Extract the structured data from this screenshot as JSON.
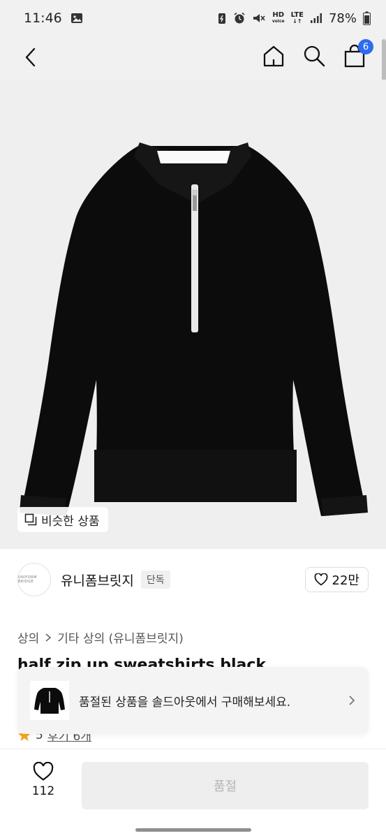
{
  "status_bar": {
    "time": "11:46",
    "hd_top": "HD",
    "hd_bottom": "voice",
    "lte": "LTE",
    "battery": "78%"
  },
  "nav": {
    "cart_count": "6"
  },
  "image": {
    "similar_label": "비슷한 상품"
  },
  "brand": {
    "logo_text": "UNIFORM BRIDGE",
    "name": "유니폼브릿지",
    "badge": "단독",
    "likes": "22만"
  },
  "breadcrumb": {
    "level1": "상의",
    "level2": "기타 상의 (유니폼브릿지)"
  },
  "product": {
    "title": "half zip up sweatshirts black",
    "rating": "5",
    "reviews": "후기 6개"
  },
  "toast": {
    "message": "품절된 상품을 솔드아웃에서 구매해보세요."
  },
  "bottom": {
    "like_count": "112",
    "soldout_label": "품절"
  },
  "colors": {
    "accent": "#2f6bf0",
    "star": "#f5a623",
    "garment": "#0c0c0c"
  }
}
